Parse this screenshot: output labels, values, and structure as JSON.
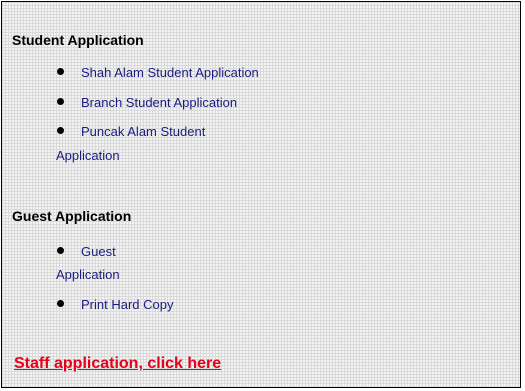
{
  "student_section": {
    "heading": "Student Application",
    "items": [
      {
        "label": "Shah Alam Student Application"
      },
      {
        "label": "Branch Student Application"
      },
      {
        "label_line1": "Puncak Alam Student",
        "label_line2": "Application"
      }
    ]
  },
  "guest_section": {
    "heading": "Guest Application",
    "items": [
      {
        "label_line1": "Guest",
        "label_line2": "Application"
      },
      {
        "label": "Print Hard Copy"
      }
    ]
  },
  "staff_link": {
    "label": "Staff application, click here",
    "color": "#e8001a"
  },
  "colors": {
    "link": "#1c1c80",
    "heading": "#000000"
  }
}
